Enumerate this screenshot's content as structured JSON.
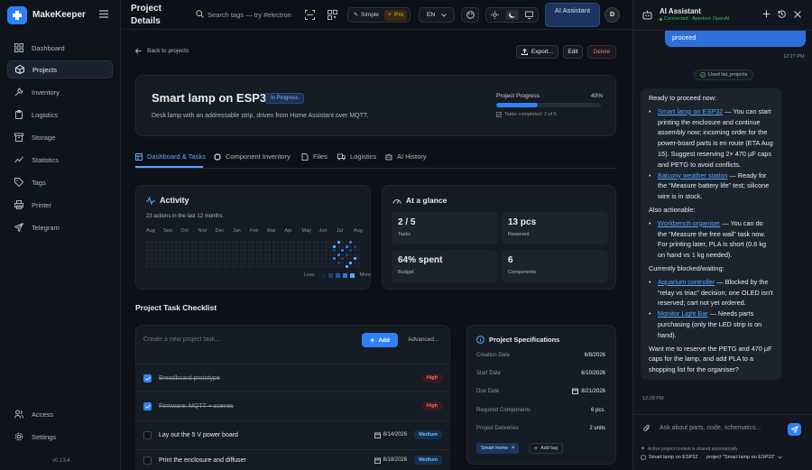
{
  "app": {
    "brand": "MakeKeeper",
    "version": "v0.13.4"
  },
  "sidebar": {
    "items": [
      {
        "label": "Dashboard",
        "icon": "grid-icon"
      },
      {
        "label": "Projects",
        "icon": "box-icon"
      },
      {
        "label": "Inventory",
        "icon": "wrench-icon"
      },
      {
        "label": "Logistics",
        "icon": "clipboard-icon"
      },
      {
        "label": "Storage",
        "icon": "archive-icon"
      },
      {
        "label": "Statistics",
        "icon": "chart-icon"
      },
      {
        "label": "Tags",
        "icon": "tag-icon"
      },
      {
        "label": "Printer",
        "icon": "printer-icon"
      },
      {
        "label": "Telegram",
        "icon": "send-icon"
      }
    ],
    "bottom": [
      {
        "label": "Access",
        "icon": "users-icon"
      },
      {
        "label": "Settings",
        "icon": "gear-icon"
      }
    ]
  },
  "topbar": {
    "page_title": "Project Details",
    "search_placeholder": "Search tags — try #electron",
    "mode_simple": "Simple",
    "mode_pro": "Pro",
    "language": "EN",
    "ai_button": "AI Assistant",
    "avatar": "D"
  },
  "main": {
    "back": "Back to projects",
    "export": "Export...",
    "edit": "Edit",
    "delete": "Delete",
    "project": {
      "name": "Smart lamp on ESP32",
      "status": "In Progress",
      "description": "Desk lamp with an addressable strip, driven from Home Assistant over MQTT.",
      "progress_label": "Project Progress",
      "progress_pct_text": "40%",
      "progress": 0.4,
      "tasks_completed": "Tasks completed: 2 of 5"
    },
    "tabs": [
      "Dashboard & Tasks",
      "Component Inventory",
      "Files",
      "Logistics",
      "AI History"
    ],
    "activity": {
      "title": "Activity",
      "subtitle": "23 actions in the last 12 months.",
      "months": [
        "Aug",
        "Sep",
        "Oct",
        "Nov",
        "Dec",
        "Jan",
        "Feb",
        "Mar",
        "Apr",
        "May",
        "Jun",
        "Jul",
        "Aug"
      ],
      "legend_less": "Less",
      "legend_more": "More"
    },
    "glance": {
      "title": "At a glance",
      "stats": [
        {
          "value": "2 / 5",
          "label": "Tasks"
        },
        {
          "value": "13 pcs",
          "label": "Reserved"
        },
        {
          "value": "64% spent",
          "label": "Budget"
        },
        {
          "value": "6",
          "label": "Components"
        }
      ]
    },
    "checklist": {
      "title": "Project Task Checklist",
      "placeholder": "Create a new project task...",
      "add": "Add",
      "advanced": "Advanced...",
      "tasks": [
        {
          "title": "Breadboard prototype",
          "done": true,
          "date": "",
          "priority": "High"
        },
        {
          "title": "Firmware: MQTT + scenes",
          "done": true,
          "date": "",
          "priority": "High"
        },
        {
          "title": "Lay out the 5 V power board",
          "done": false,
          "date": "8/14/2026",
          "priority": "Medium"
        },
        {
          "title": "Print the enclosure and diffuser",
          "done": false,
          "date": "8/18/2026",
          "priority": "Medium"
        }
      ]
    },
    "specs": {
      "title": "Project Specifications",
      "rows": [
        {
          "label": "Creation Date",
          "value": "6/8/2026"
        },
        {
          "label": "Start Date",
          "value": "6/10/2026"
        },
        {
          "label": "Due Date",
          "value": "8/21/2026"
        },
        {
          "label": "Required Components",
          "value": "6 pcs."
        },
        {
          "label": "Project Deliveries",
          "value": "2 units"
        }
      ],
      "tag": "Smart home",
      "add_tag": "Add tag"
    }
  },
  "chat": {
    "title": "AI Assistant",
    "status": "Connected · Aperture OpenAI",
    "user_msg": "Let me know when projects are ready to proceed",
    "user_time": "12:27 PM",
    "tool_used": "Used list_projects",
    "reply": {
      "intro": "Ready to proceed now:",
      "ready": [
        {
          "link": "Smart lamp on ESP32",
          "text": " — You can start printing the enclosure and continue assembly now; incoming order for the power-board parts is en route (ETA Aug 15). Suggest reserving 2× 470 µF caps and PETG to avoid conflicts."
        },
        {
          "link": "Balcony weather station",
          "text": " — Ready for the “Measure battery life” test; silicone wire is in stock."
        }
      ],
      "also_title": "Also actionable:",
      "also": [
        {
          "link": "Workbench organiser",
          "text": " — You can do the “Measure the free wall” task now. For printing later, PLA is short (0.6 kg on hand vs 1 kg needed)."
        }
      ],
      "blocked_title": "Currently blocked/waiting:",
      "blocked": [
        {
          "link": "Aquarium controller",
          "text": " — Blocked by the “relay vs triac” decision; one OLED isn't reserved; cart not yet ordered."
        },
        {
          "link": "Monitor Light Bar",
          "text": " — Needs parts purchasing (only the LED strip is on hand)."
        }
      ],
      "outro": "Want me to reserve the PETG and 470 µF caps for the lamp, and add PLA to a shopping list for the organiser?"
    },
    "reply_time": "12:28 PM",
    "input_placeholder": "Ask about parts, code, schematics...",
    "context_note": "Active project context is shared automatically",
    "context_project": "Smart lamp on ESP32",
    "context_chip": "project \"Smart lamp on ESP32\""
  }
}
